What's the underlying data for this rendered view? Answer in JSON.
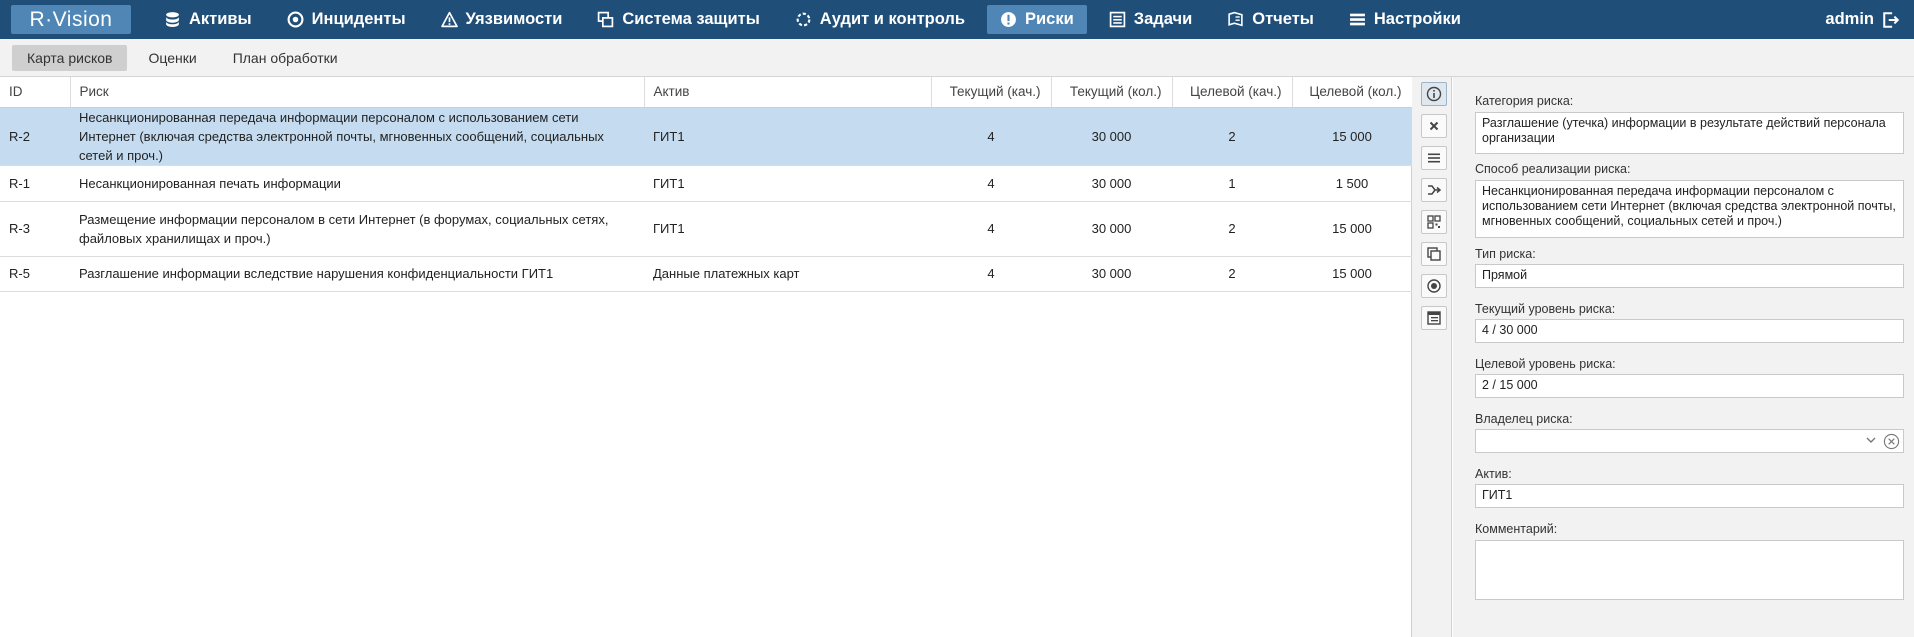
{
  "app": {
    "logo": "R·Vision"
  },
  "nav": {
    "items": [
      {
        "label": "Активы",
        "icon": "database-icon"
      },
      {
        "label": "Инциденты",
        "icon": "target-icon"
      },
      {
        "label": "Уязвимости",
        "icon": "warning-icon"
      },
      {
        "label": "Система защиты",
        "icon": "windows-icon"
      },
      {
        "label": "Аудит и контроль",
        "icon": "refresh-icon"
      },
      {
        "label": "Риски",
        "icon": "alert-circle-icon",
        "active": true
      },
      {
        "label": "Задачи",
        "icon": "task-list-icon"
      },
      {
        "label": "Отчеты",
        "icon": "report-icon"
      },
      {
        "label": "Настройки",
        "icon": "menu-icon"
      }
    ],
    "user": "admin"
  },
  "subtabs": [
    {
      "label": "Карта рисков",
      "active": true
    },
    {
      "label": "Оценки"
    },
    {
      "label": "План обработки"
    }
  ],
  "table": {
    "columns": [
      "ID",
      "Риск",
      "Актив",
      "Текущий (кач.)",
      "Текущий (кол.)",
      "Целевой (кач.)",
      "Целевой (кол.)"
    ],
    "rows": [
      {
        "id": "R-2",
        "risk": "Несанкционированная передача информации персоналом с использованием сети Интернет (включая средства электронной почты, мгновенных сообщений, социальных сетей и проч.)",
        "asset": "ГИТ1",
        "cur_q": "4",
        "cur_n": "30 000",
        "tgt_q": "2",
        "tgt_n": "15 000",
        "selected": true
      },
      {
        "id": "R-1",
        "risk": "Несанкционированная печать информации",
        "asset": "ГИТ1",
        "cur_q": "4",
        "cur_n": "30 000",
        "tgt_q": "1",
        "tgt_n": "1 500"
      },
      {
        "id": "R-3",
        "risk": "Размещение информации персоналом в сети Интернет (в форумах, социальных сетях, файловых хранилищах и проч.)",
        "asset": "ГИТ1",
        "cur_q": "4",
        "cur_n": "30 000",
        "tgt_q": "2",
        "tgt_n": "15 000"
      },
      {
        "id": "R-5",
        "risk": "Разглашение информации вследствие нарушения конфиденциальности ГИТ1",
        "asset": "Данные платежных карт",
        "cur_q": "4",
        "cur_n": "30 000",
        "tgt_q": "2",
        "tgt_n": "15 000"
      }
    ]
  },
  "toolbar": {
    "icons": [
      "info-icon",
      "close-icon",
      "list-icon",
      "merge-icon",
      "qr-icon",
      "copy-icon",
      "radio-icon",
      "table-icon"
    ]
  },
  "details": {
    "category_label": "Категория риска:",
    "category_value": "Разглашение (утечка) информации в результате действий персонала организации",
    "method_label": "Способ реализации риска:",
    "method_value": "Несанкционированная передача информации персоналом с использованием сети Интернет (включая средства электронной почты, мгновенных сообщений, социальных сетей и проч.)",
    "type_label": "Тип риска:",
    "type_value": "Прямой",
    "current_label": "Текущий уровень риска:",
    "current_value": "4 / 30 000",
    "target_label": "Целевой уровень риска:",
    "target_value": "2 / 15 000",
    "owner_label": "Владелец риска:",
    "owner_value": "",
    "asset_label": "Актив:",
    "asset_value": "ГИТ1",
    "comment_label": "Комментарий:",
    "comment_value": ""
  }
}
